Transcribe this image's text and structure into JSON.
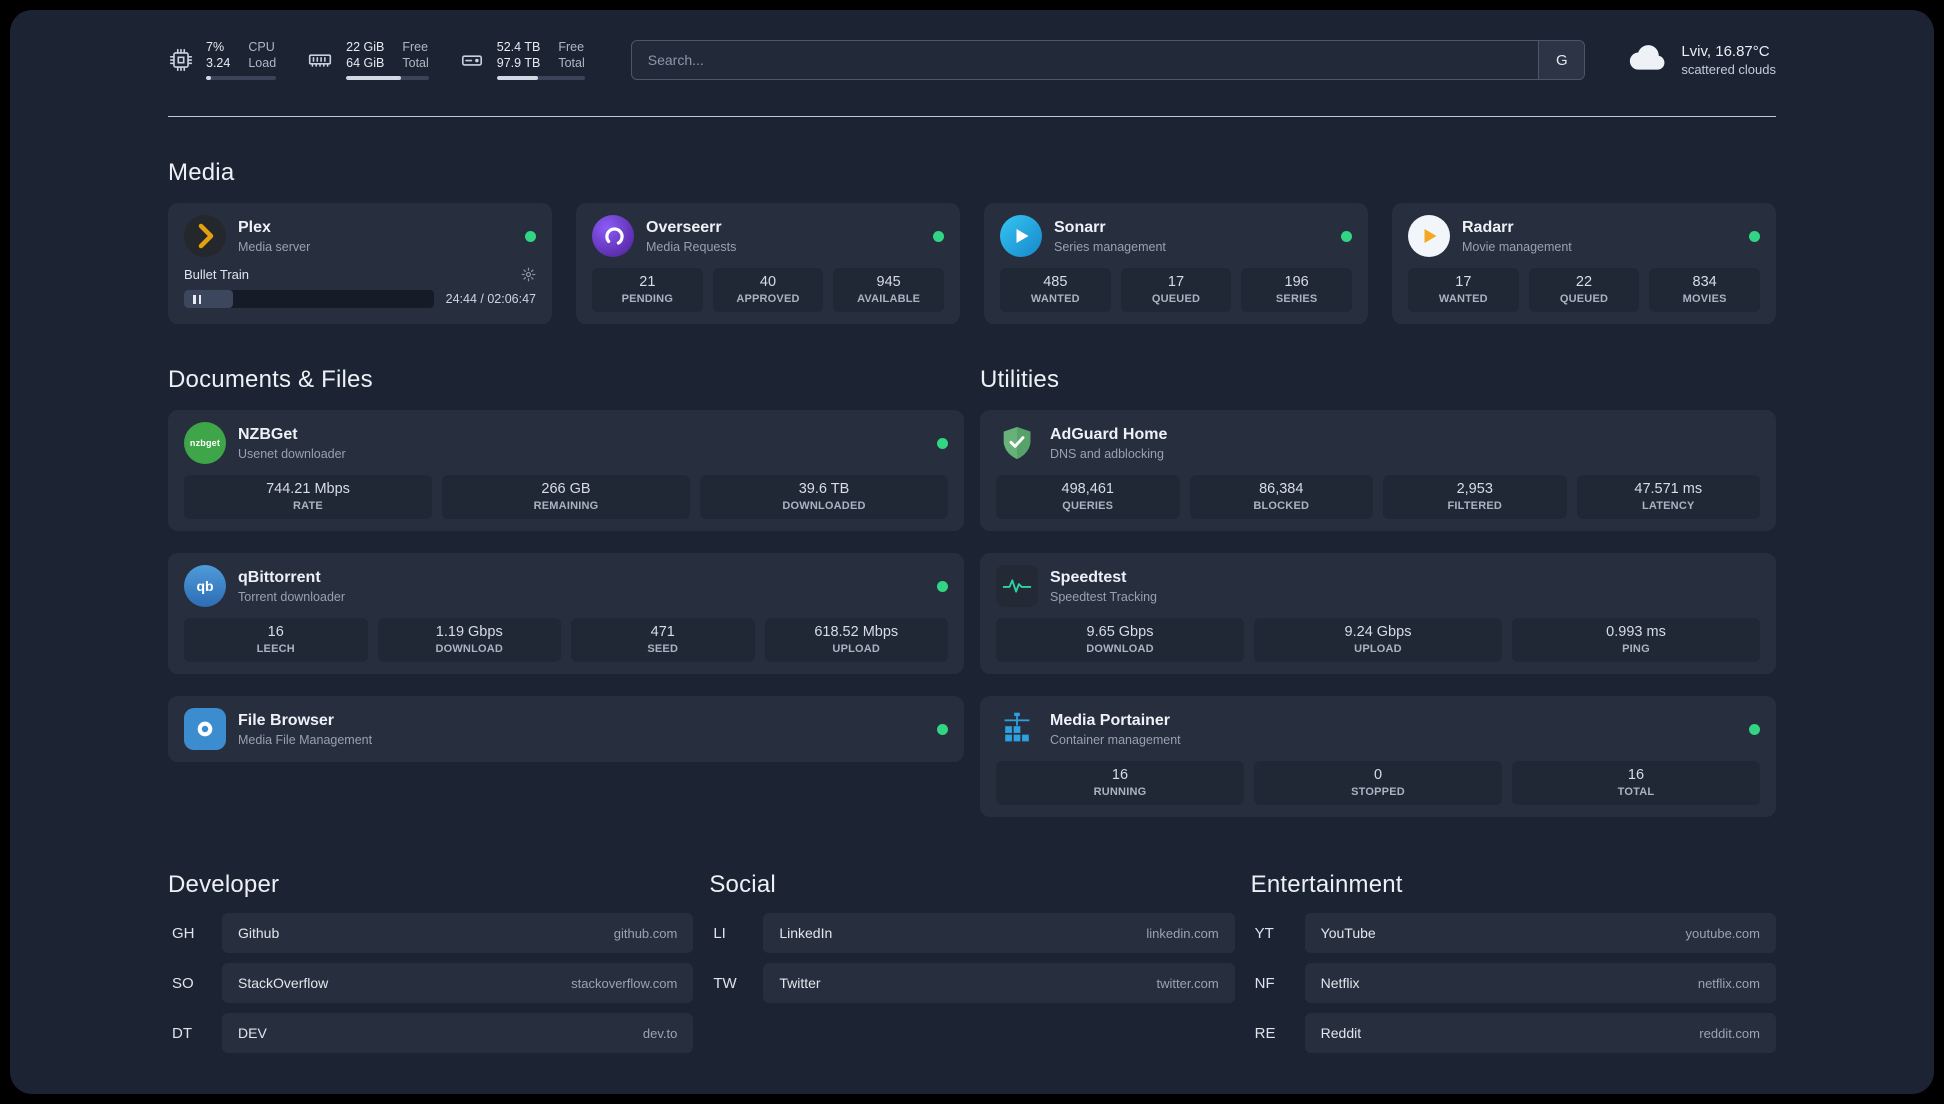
{
  "colors": {
    "status_online": "#32d583",
    "page_background": "#1c2433",
    "card_background": "#272f3e"
  },
  "header": {
    "cpu": {
      "value_top": "7%",
      "label_top": "CPU",
      "value_bottom": "3.24",
      "label_bottom": "Load",
      "progress_pct": 7
    },
    "memory": {
      "value_top": "22 GiB",
      "label_top": "Free",
      "value_bottom": "64 GiB",
      "label_bottom": "Total",
      "progress_pct": 66
    },
    "disk": {
      "value_top": "52.4 TB",
      "label_top": "Free",
      "value_bottom": "97.9 TB",
      "label_bottom": "Total",
      "progress_pct": 47
    },
    "search": {
      "placeholder": "Search...",
      "provider": "G"
    },
    "weather": {
      "location": "Lviv, 16.87°C",
      "condition": "scattered clouds"
    }
  },
  "media": {
    "title": "Media",
    "plex": {
      "name": "Plex",
      "desc": "Media server",
      "now_playing": "Bullet Train",
      "time": "24:44 / 02:06:47",
      "progress_pct": 19.5
    },
    "overseerr": {
      "name": "Overseerr",
      "desc": "Media Requests",
      "stats": [
        {
          "value": "21",
          "label": "PENDING"
        },
        {
          "value": "40",
          "label": "APPROVED"
        },
        {
          "value": "945",
          "label": "AVAILABLE"
        }
      ]
    },
    "sonarr": {
      "name": "Sonarr",
      "desc": "Series management",
      "stats": [
        {
          "value": "485",
          "label": "WANTED"
        },
        {
          "value": "17",
          "label": "QUEUED"
        },
        {
          "value": "196",
          "label": "SERIES"
        }
      ]
    },
    "radarr": {
      "name": "Radarr",
      "desc": "Movie management",
      "stats": [
        {
          "value": "17",
          "label": "WANTED"
        },
        {
          "value": "22",
          "label": "QUEUED"
        },
        {
          "value": "834",
          "label": "MOVIES"
        }
      ]
    }
  },
  "documents": {
    "title": "Documents & Files",
    "nzbget": {
      "name": "NZBGet",
      "desc": "Usenet downloader",
      "icon_text": "nzbget",
      "stats": [
        {
          "value": "744.21 Mbps",
          "label": "RATE"
        },
        {
          "value": "266 GB",
          "label": "REMAINING"
        },
        {
          "value": "39.6 TB",
          "label": "DOWNLOADED"
        }
      ]
    },
    "qbittorrent": {
      "name": "qBittorrent",
      "desc": "Torrent downloader",
      "icon_text": "qb",
      "stats": [
        {
          "value": "16",
          "label": "LEECH"
        },
        {
          "value": "1.19 Gbps",
          "label": "DOWNLOAD"
        },
        {
          "value": "471",
          "label": "SEED"
        },
        {
          "value": "618.52 Mbps",
          "label": "UPLOAD"
        }
      ]
    },
    "filebrowser": {
      "name": "File Browser",
      "desc": "Media File Management"
    }
  },
  "utilities": {
    "title": "Utilities",
    "adguard": {
      "name": "AdGuard Home",
      "desc": "DNS and adblocking",
      "stats": [
        {
          "value": "498,461",
          "label": "QUERIES"
        },
        {
          "value": "86,384",
          "label": "BLOCKED"
        },
        {
          "value": "2,953",
          "label": "FILTERED"
        },
        {
          "value": "47.571 ms",
          "label": "LATENCY"
        }
      ]
    },
    "speedtest": {
      "name": "Speedtest",
      "desc": "Speedtest Tracking",
      "stats": [
        {
          "value": "9.65 Gbps",
          "label": "DOWNLOAD"
        },
        {
          "value": "9.24 Gbps",
          "label": "UPLOAD"
        },
        {
          "value": "0.993 ms",
          "label": "PING"
        }
      ]
    },
    "portainer": {
      "name": "Media Portainer",
      "desc": "Container management",
      "stats": [
        {
          "value": "16",
          "label": "RUNNING"
        },
        {
          "value": "0",
          "label": "STOPPED"
        },
        {
          "value": "16",
          "label": "TOTAL"
        }
      ]
    }
  },
  "bookmarks": {
    "developer": {
      "title": "Developer",
      "items": [
        {
          "abbr": "GH",
          "name": "Github",
          "url": "github.com"
        },
        {
          "abbr": "SO",
          "name": "StackOverflow",
          "url": "stackoverflow.com"
        },
        {
          "abbr": "DT",
          "name": "DEV",
          "url": "dev.to"
        }
      ]
    },
    "social": {
      "title": "Social",
      "items": [
        {
          "abbr": "LI",
          "name": "LinkedIn",
          "url": "linkedin.com"
        },
        {
          "abbr": "TW",
          "name": "Twitter",
          "url": "twitter.com"
        }
      ]
    },
    "entertainment": {
      "title": "Entertainment",
      "items": [
        {
          "abbr": "YT",
          "name": "YouTube",
          "url": "youtube.com"
        },
        {
          "abbr": "NF",
          "name": "Netflix",
          "url": "netflix.com"
        },
        {
          "abbr": "RE",
          "name": "Reddit",
          "url": "reddit.com"
        }
      ]
    }
  }
}
